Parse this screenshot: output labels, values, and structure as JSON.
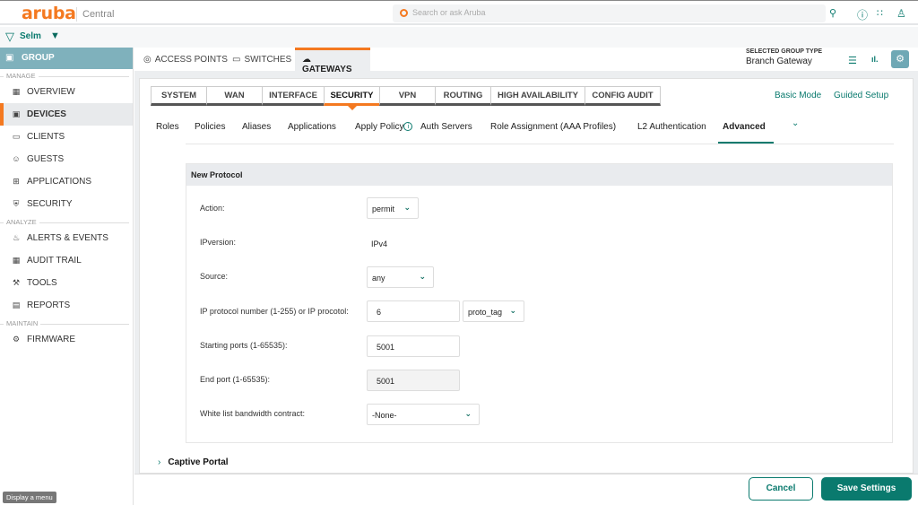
{
  "header": {
    "logo": "aruba",
    "product": "Central",
    "search_placeholder": "Search or ask Aruba"
  },
  "filter": {
    "label": "Selm"
  },
  "sidebar": {
    "group_label": "GROUP",
    "sections": {
      "manage": "MANAGE",
      "analyze": "ANALYZE",
      "maintain": "MAINTAIN"
    },
    "items": [
      {
        "label": "OVERVIEW",
        "icon": "overview-icon"
      },
      {
        "label": "DEVICES",
        "icon": "devices-icon",
        "active": true
      },
      {
        "label": "CLIENTS",
        "icon": "clients-icon"
      },
      {
        "label": "GUESTS",
        "icon": "guests-icon"
      },
      {
        "label": "APPLICATIONS",
        "icon": "applications-icon"
      },
      {
        "label": "SECURITY",
        "icon": "security-icon"
      },
      {
        "label": "ALERTS & EVENTS",
        "icon": "bell-icon"
      },
      {
        "label": "AUDIT TRAIL",
        "icon": "audit-icon"
      },
      {
        "label": "TOOLS",
        "icon": "wrench-icon"
      },
      {
        "label": "REPORTS",
        "icon": "reports-icon"
      },
      {
        "label": "FIRMWARE",
        "icon": "firmware-icon"
      }
    ],
    "tooltip": "Display a menu"
  },
  "device_tabs": [
    {
      "label": "ACCESS POINTS"
    },
    {
      "label": "SWITCHES"
    },
    {
      "label": "GATEWAYS",
      "active": true
    }
  ],
  "group_type": {
    "label": "SELECTED GROUP TYPE",
    "value": "Branch Gateway"
  },
  "config_tabs": [
    {
      "label": "SYSTEM"
    },
    {
      "label": "WAN"
    },
    {
      "label": "INTERFACE"
    },
    {
      "label": "SECURITY",
      "active": true
    },
    {
      "label": "VPN"
    },
    {
      "label": "ROUTING"
    },
    {
      "label": "HIGH AVAILABILITY"
    },
    {
      "label": "CONFIG AUDIT"
    }
  ],
  "mode_links": {
    "basic": "Basic Mode",
    "guided": "Guided Setup"
  },
  "sub_tabs": [
    {
      "label": "Roles"
    },
    {
      "label": "Policies"
    },
    {
      "label": "Aliases"
    },
    {
      "label": "Applications"
    },
    {
      "label": "Apply Policy"
    },
    {
      "label": "Auth Servers"
    },
    {
      "label": "Role Assignment (AAA Profiles)"
    },
    {
      "label": "L2 Authentication"
    },
    {
      "label": "Advanced",
      "active": true
    }
  ],
  "form": {
    "title": "New Protocol",
    "action": {
      "label": "Action:",
      "value": "permit"
    },
    "ipversion": {
      "label": "IPversion:",
      "value": "IPv4"
    },
    "source": {
      "label": "Source:",
      "value": "any"
    },
    "ip_protocol": {
      "label": "IP protocol number (1-255) or IP procotol:",
      "value": "6",
      "tag": "proto_tag"
    },
    "start_port": {
      "label": "Starting ports (1-65535):",
      "value": "5001"
    },
    "end_port": {
      "label": "End port (1-65535):",
      "value": "5001"
    },
    "bandwidth": {
      "label": "White list bandwidth contract:",
      "value": "-None-"
    }
  },
  "captive_portal": "Captive Portal",
  "footer": {
    "cancel": "Cancel",
    "save": "Save Settings"
  },
  "colors": {
    "brand_orange": "#f47920",
    "accent_teal": "#0a7a6e",
    "group_header": "#7fb1bc"
  }
}
